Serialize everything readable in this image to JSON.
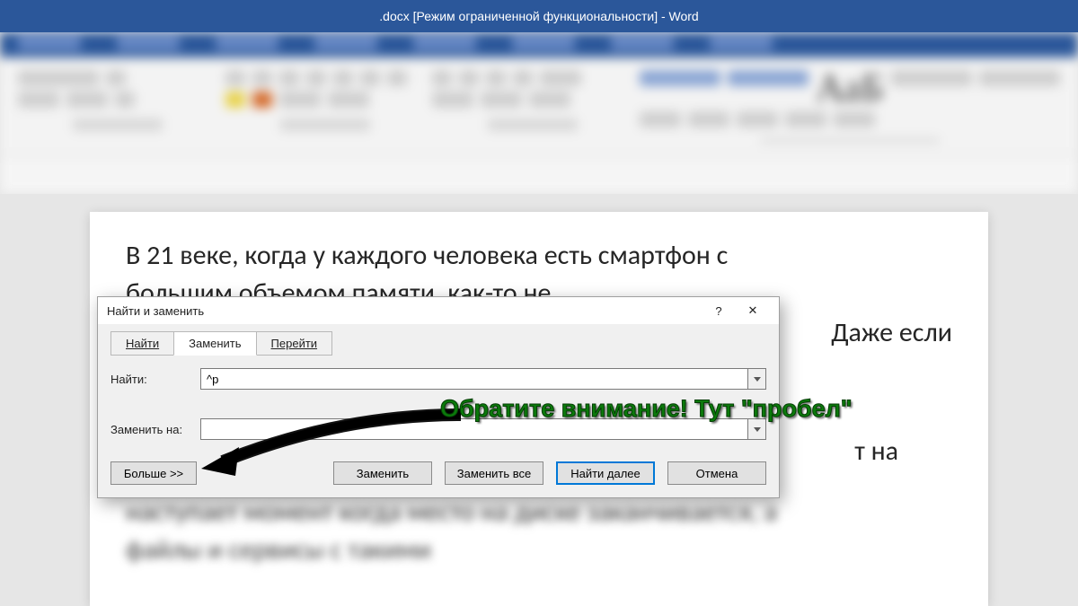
{
  "titlebar": ".docx [Режим ограниченной функциональности]  -  Word",
  "document": {
    "line1": "В 21 веке, когда у каждого человека есть смартфон с",
    "line2": "большим объемом памяти, как-то не",
    "fragment_right": "Даже если",
    "fragment_mid": "т на"
  },
  "dialog": {
    "title": "Найти и заменить",
    "help": "?",
    "close": "✕",
    "tabs": {
      "find": "Найти",
      "replace": "Заменить",
      "goto": "Перейти"
    },
    "find_label": "Найти:",
    "find_value": "^p",
    "replace_label": "Заменить на:",
    "replace_value": " ",
    "buttons": {
      "more": "Больше >>",
      "replace": "Заменить",
      "replace_all": "Заменить все",
      "find_next": "Найти далее",
      "cancel": "Отмена"
    }
  },
  "annotation": "Обратите внимание! Тут \"пробел\""
}
